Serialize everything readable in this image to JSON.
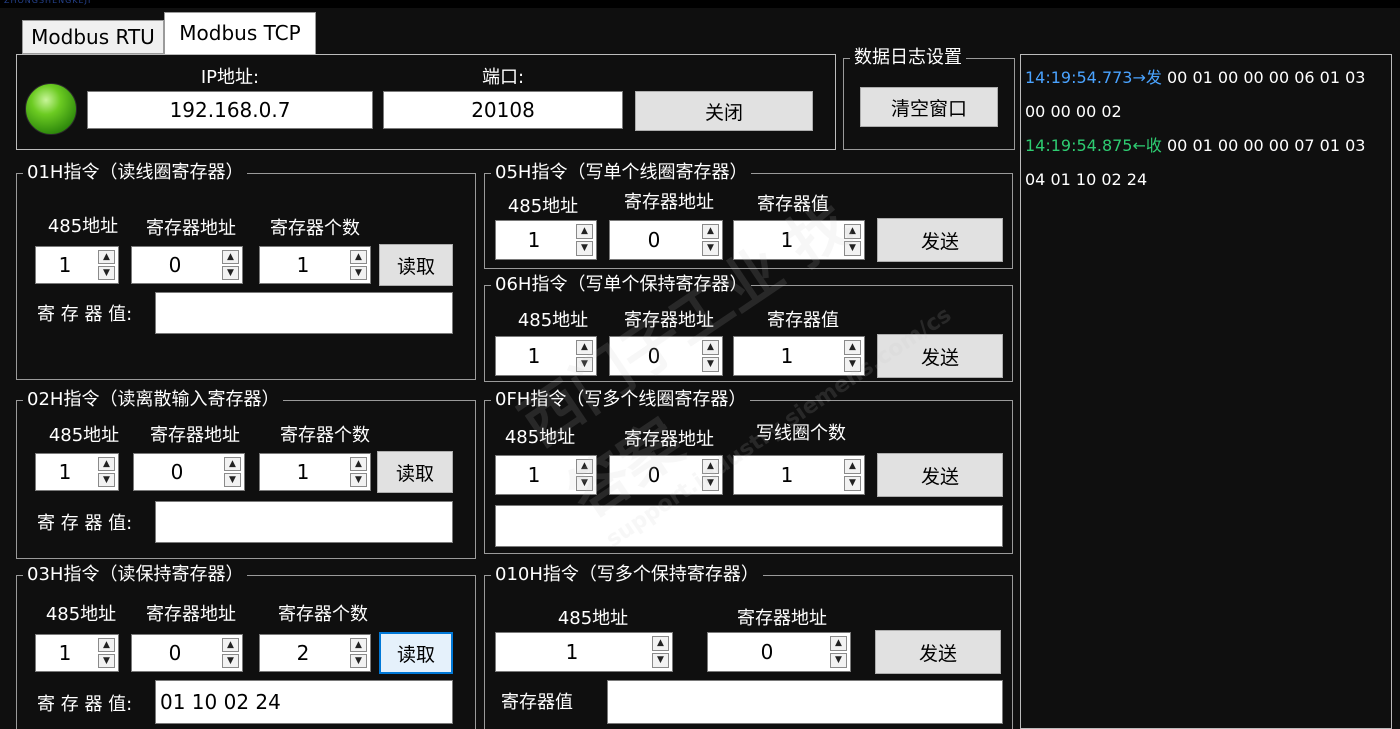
{
  "tabs": [
    {
      "label": "Modbus RTU",
      "active": false
    },
    {
      "label": "Modbus TCP",
      "active": true
    }
  ],
  "connection": {
    "ip_label": "IP地址:",
    "ip_value": "192.168.0.7",
    "port_label": "端口:",
    "port_value": "20108",
    "close_button": "关闭",
    "status_color": "#4cb81a"
  },
  "log_settings": {
    "title": "数据日志设置",
    "clear_button": "清空窗口"
  },
  "log": {
    "line1_ts": "14:19:54.773→发",
    "line1_data": "00 01 00 00 00 06 01 03",
    "line2_data": "00 00 00 02",
    "line3_ts": "14:19:54.875←收",
    "line3_data": "00 01 00 00 00 07 01 03",
    "line4_data": "04 01 10 02 24",
    "send_color": "#4aa3ff",
    "recv_color": "#2ecc71"
  },
  "f01": {
    "title": "01H指令（读线圈寄存器）",
    "addr_label": "485地址",
    "reg_label": "寄存器地址",
    "count_label": "寄存器个数",
    "addr": "1",
    "reg": "0",
    "count": "1",
    "read_button": "读取",
    "value_label": "寄 存 器 值:",
    "value": ""
  },
  "f02": {
    "title": "02H指令（读离散输入寄存器）",
    "addr_label": "485地址",
    "reg_label": "寄存器地址",
    "count_label": "寄存器个数",
    "addr": "1",
    "reg": "0",
    "count": "1",
    "read_button": "读取",
    "value_label": "寄 存 器 值:",
    "value": ""
  },
  "f03": {
    "title": "03H指令（读保持寄存器）",
    "addr_label": "485地址",
    "reg_label": "寄存器地址",
    "count_label": "寄存器个数",
    "addr": "1",
    "reg": "0",
    "count": "2",
    "read_button": "读取",
    "value_label": "寄 存 器 值:",
    "value": "01 10 02 24"
  },
  "f05": {
    "title": "05H指令（写单个线圈寄存器）",
    "addr_label": "485地址",
    "reg_label": "寄存器地址",
    "val_label": "寄存器值",
    "addr": "1",
    "reg": "0",
    "val": "1",
    "send_button": "发送"
  },
  "f06": {
    "title": "06H指令（写单个保持寄存器）",
    "addr_label": "485地址",
    "reg_label": "寄存器地址",
    "val_label": "寄存器值",
    "addr": "1",
    "reg": "0",
    "val": "1",
    "send_button": "发送"
  },
  "f0f": {
    "title": "0FH指令（写多个线圈寄存器）",
    "addr_label": "485地址",
    "reg_label": "寄存器地址",
    "count_label": "写线圈个数",
    "addr": "1",
    "reg": "0",
    "count": "1",
    "send_button": "发送",
    "values": ""
  },
  "f10": {
    "title": "010H指令（写多个保持寄存器）",
    "addr_label": "485地址",
    "reg_label": "寄存器地址",
    "addr": "1",
    "reg": "0",
    "send_button": "发送",
    "value_label": "寄存器值",
    "value": ""
  },
  "watermark": {
    "line1": "西门子工业 找答案",
    "line2": "support.industry.siemens.com/cs"
  },
  "icons": {
    "spin_up": "▲",
    "spin_down": "▼"
  }
}
